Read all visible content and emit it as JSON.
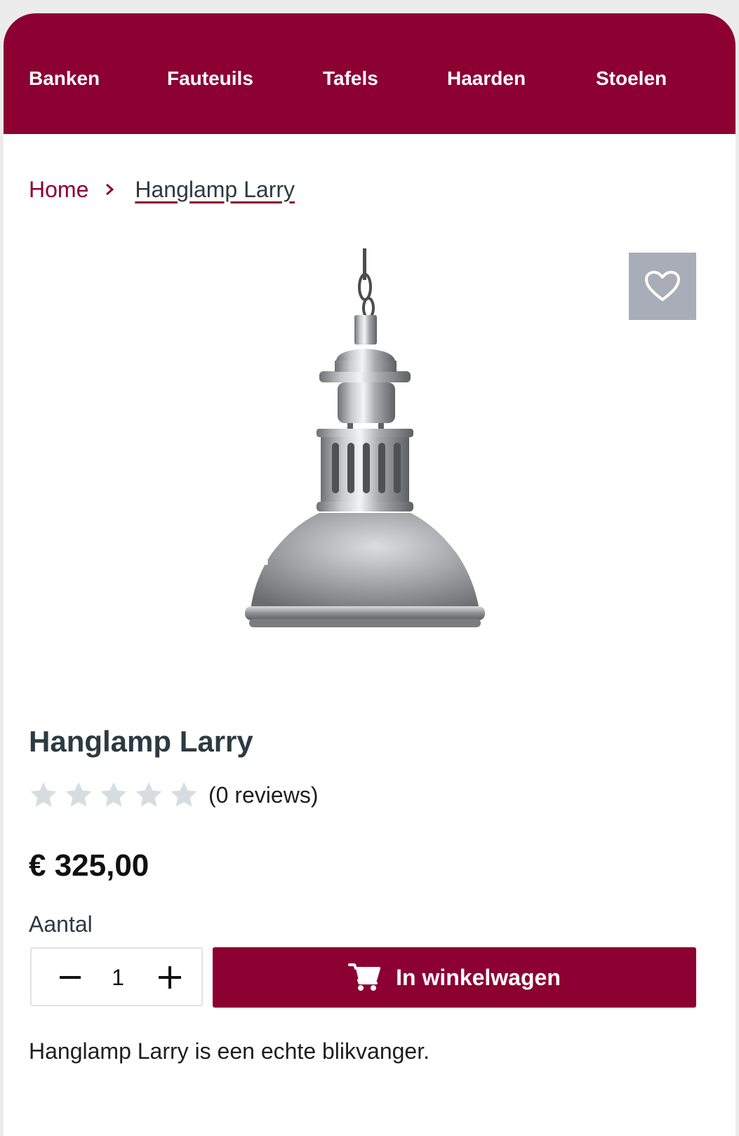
{
  "nav": {
    "items": [
      {
        "label": "Banken"
      },
      {
        "label": "Fauteuils"
      },
      {
        "label": "Tafels"
      },
      {
        "label": "Haarden"
      },
      {
        "label": "Stoelen"
      }
    ]
  },
  "breadcrumb": {
    "home": "Home",
    "current": "Hanglamp Larry"
  },
  "product": {
    "title": "Hanglamp Larry",
    "rating": {
      "stars_filled": 0,
      "stars_total": 5,
      "reviews_text": "(0 reviews)"
    },
    "price": "€ 325,00",
    "quantity_label": "Aantal",
    "quantity_value": "1",
    "add_to_cart_label": "In winkelwagen",
    "description": "Hanglamp Larry is een echte blikvanger."
  },
  "icons": {
    "favorite": "heart-icon",
    "cart": "shopping-cart-icon",
    "separator": "chevron-right-icon",
    "minus": "minus-icon",
    "plus": "plus-icon",
    "star": "star-icon"
  },
  "colors": {
    "brand": "#8c0032",
    "favorite_bg": "#a8adb7",
    "star_empty": "#d6dde0",
    "text_dark": "#2c3a42"
  }
}
